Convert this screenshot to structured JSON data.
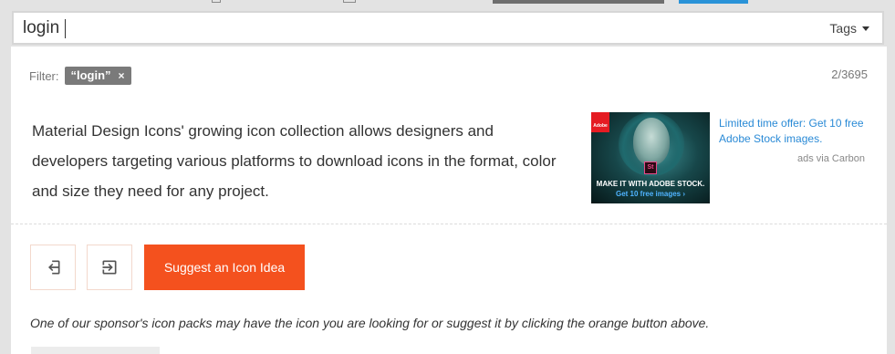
{
  "search": {
    "value": "login",
    "tags_label": "Tags"
  },
  "filter": {
    "label": "Filter:",
    "chip_text": "“login”",
    "chip_remove": "×",
    "count": "2/3695"
  },
  "description": "Material Design Icons' growing icon collection allows designers and developers targeting various platforms to download icons in the format, color and size they need for any project.",
  "ad": {
    "logo_text": "Adobe",
    "product_badge": "St",
    "image_line1": "MAKE IT WITH ADOBE STOCK.",
    "image_line2": "Get 10 free images ›",
    "offer_text": "Limited time offer: Get 10 free Adobe Stock images.",
    "via_text": "ads via Carbon"
  },
  "actions": {
    "icon1": "login-icon",
    "icon2": "exit-to-app-icon",
    "suggest_label": "Suggest an Icon Idea"
  },
  "note": "One of our sponsor's icon packs may have the icon you are looking for or suggest it by clicking the orange button above.",
  "colors": {
    "accent": "#f4511e",
    "link": "#2a8ad6",
    "chip": "#7a7a7a"
  }
}
